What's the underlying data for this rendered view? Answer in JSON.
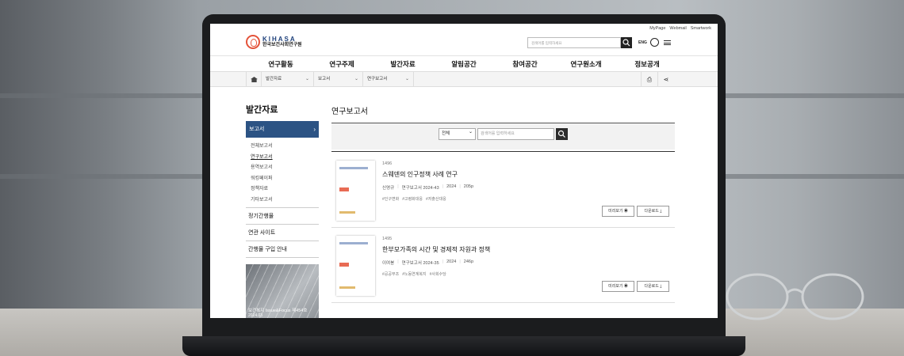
{
  "header": {
    "toplinks": [
      "MyPage",
      "Webmail",
      "Smartwork"
    ],
    "logo_en": "KIHASA",
    "logo_ko": "한국보건사회연구원",
    "search_placeholder": "검색어를 입력하세요",
    "lang": "ENG"
  },
  "gnb": [
    "연구활동",
    "연구주제",
    "발간자료",
    "알림공간",
    "참여공간",
    "연구원소개",
    "정보공개"
  ],
  "breadcrumb": [
    "발간자료",
    "보고서",
    "연구보고서"
  ],
  "sidebar": {
    "title": "발간자료",
    "active": "보고서",
    "sub_items": [
      "전체보고서",
      "연구보고서",
      "용역보고서",
      "워킹페이퍼",
      "정책자료",
      "기타보고서"
    ],
    "active_sub": "연구보고서",
    "items": [
      "정기간행물",
      "연관 사이트",
      "간행물 구입 안내"
    ],
    "banner_title": "보건복지 Issue&Focus 제454호",
    "banner_date": "2024.03"
  },
  "main": {
    "title": "연구보고서",
    "search_select": "전체",
    "search_placeholder": "검색어를 입력하세요",
    "items": [
      {
        "number": "1496",
        "title": "스웨덴의 인구정책 사례 연구",
        "author": "신영규",
        "series": "연구보고서 2024-43",
        "year": "2024",
        "pages": "205p",
        "tags": [
          "#인구변화",
          "#고령화대응",
          "#저출산대응"
        ],
        "preview": "미리보기",
        "download": "다운로드"
      },
      {
        "number": "1495",
        "title": "한부모가족의 시간 및 경제적 자원과 정책",
        "author": "이여봉",
        "series": "연구보고서 2024-35",
        "year": "2024",
        "pages": "246p",
        "tags": [
          "#공공부조",
          "#노동연계복지",
          "#사회수당"
        ],
        "preview": "미리보기",
        "download": "다운로드"
      }
    ]
  },
  "colors": {
    "primary": "#2c5384",
    "logo_accent": "#e4533a"
  }
}
